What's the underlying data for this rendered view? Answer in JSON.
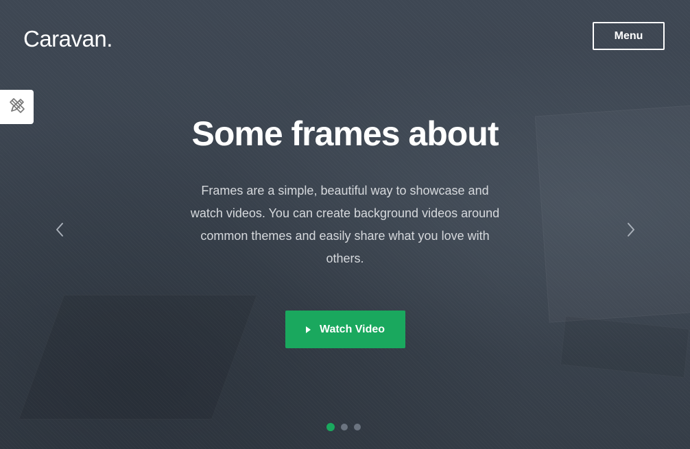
{
  "header": {
    "logo": "Caravan.",
    "menu_label": "Menu"
  },
  "hero": {
    "headline": "Some frames about",
    "description": "Frames are a simple, beautiful way to showcase and watch videos. You can create background videos around common themes and easily share what you love with others.",
    "cta_label": "Watch Video"
  },
  "slider": {
    "slide_count": 3,
    "active_slide": 1
  },
  "icons": {
    "tool_tab": "design-tools-icon",
    "cta": "play-icon",
    "prev": "chevron-left-icon",
    "next": "chevron-right-icon"
  },
  "colors": {
    "accent": "#1aa85e",
    "background": "#3c4550",
    "text": "#ffffff",
    "muted_text": "#d6d9dd",
    "inactive_dot": "#6b7480"
  }
}
